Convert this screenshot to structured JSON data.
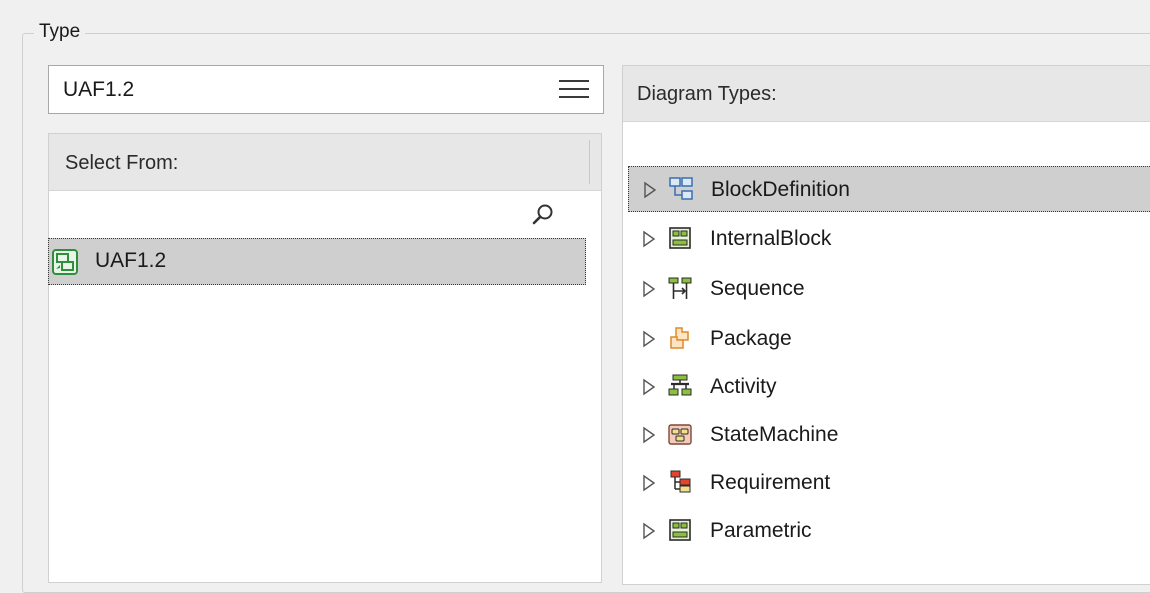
{
  "group": {
    "legend": "Type"
  },
  "combo": {
    "value": "UAF1.2",
    "menu_icon": "hamburger-menu-icon"
  },
  "select_from": {
    "header": "Select From:",
    "search_icon": "search-icon",
    "items": [
      {
        "label": "UAF1.2",
        "icon": "uaf-technology-icon",
        "selected": true
      }
    ]
  },
  "diagram_types": {
    "header": "Diagram Types:",
    "items": [
      {
        "label": "BlockDefinition",
        "icon": "block-definition-icon",
        "selected": true
      },
      {
        "label": "InternalBlock",
        "icon": "internal-block-icon",
        "selected": false
      },
      {
        "label": "Sequence",
        "icon": "sequence-icon",
        "selected": false
      },
      {
        "label": "Package",
        "icon": "package-icon",
        "selected": false
      },
      {
        "label": "Activity",
        "icon": "activity-icon",
        "selected": false
      },
      {
        "label": "StateMachine",
        "icon": "state-machine-icon",
        "selected": false
      },
      {
        "label": "Requirement",
        "icon": "requirement-icon",
        "selected": false
      },
      {
        "label": "Parametric",
        "icon": "parametric-icon",
        "selected": false
      }
    ]
  },
  "colors": {
    "selection": "#cfcfcf",
    "header_bg": "#e7e7e7",
    "window_bg": "#f0f0f0"
  }
}
